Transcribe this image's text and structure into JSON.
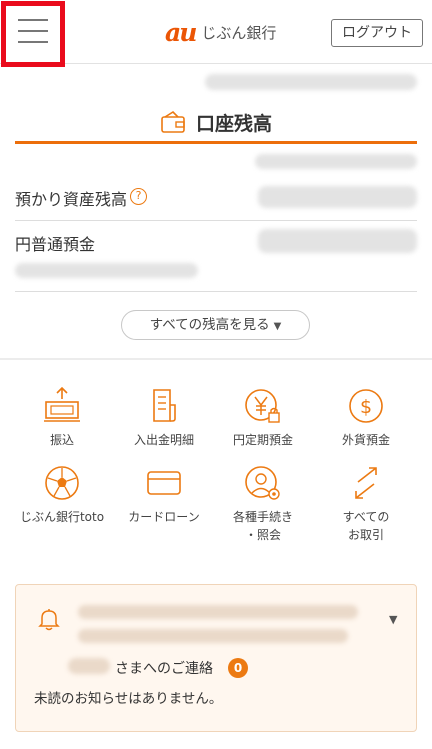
{
  "header": {
    "logo_brand": "au",
    "logo_name": "じぶん銀行",
    "logout_label": "ログアウト"
  },
  "balance": {
    "title": "口座残高",
    "assets_label": "預かり資産残高",
    "help_symbol": "?",
    "ordinary_label": "円普通預金",
    "show_all_label": "すべての残高を見る"
  },
  "menu": {
    "items": [
      {
        "label": "振込",
        "icon": "transfer-icon"
      },
      {
        "label": "入出金明細",
        "icon": "statement-icon"
      },
      {
        "label": "円定期預金",
        "icon": "yen-time-deposit-icon"
      },
      {
        "label": "外貨預金",
        "icon": "dollar-deposit-icon"
      },
      {
        "label": "じぶん銀行toto",
        "icon": "soccer-ball-icon"
      },
      {
        "label": "カードローン",
        "icon": "card-icon"
      },
      {
        "label": "各種手続き\n・照会",
        "icon": "person-settings-icon"
      },
      {
        "label": "すべての\nお取引",
        "icon": "arrows-icon"
      }
    ]
  },
  "notice": {
    "contact_label": "さまへのご連絡",
    "unread_count": "0",
    "message": "未読のお知らせはありません。"
  },
  "colors": {
    "accent": "#ec7a12",
    "brand": "#eb5505",
    "highlight_border": "#ea0b1c"
  }
}
